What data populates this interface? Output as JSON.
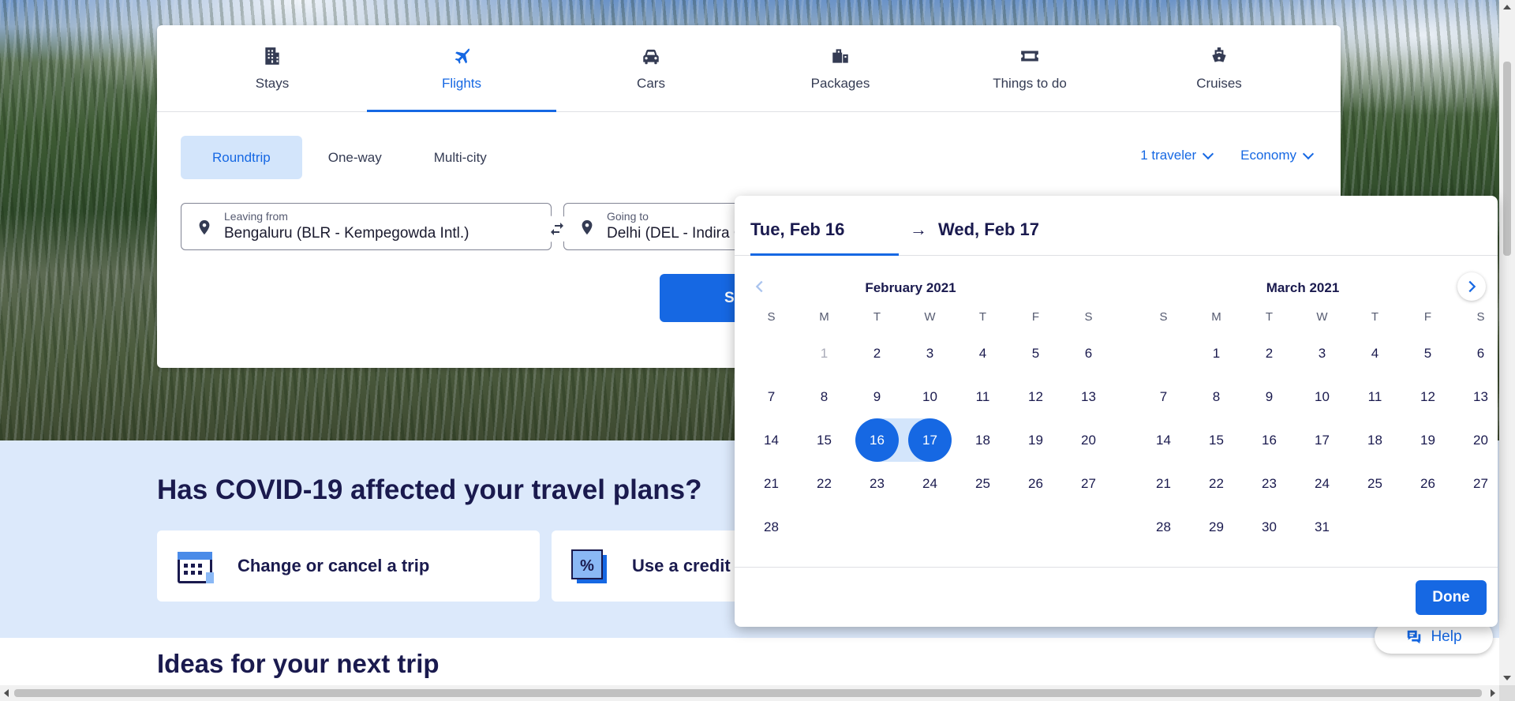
{
  "nav_tabs": [
    {
      "label": "Stays",
      "icon": "building-icon"
    },
    {
      "label": "Flights",
      "icon": "airplane-icon"
    },
    {
      "label": "Cars",
      "icon": "car-icon"
    },
    {
      "label": "Packages",
      "icon": "luggage-icon"
    },
    {
      "label": "Things to do",
      "icon": "ticket-icon"
    },
    {
      "label": "Cruises",
      "icon": "ship-icon"
    }
  ],
  "active_tab": "Flights",
  "trip_types": {
    "roundtrip": "Roundtrip",
    "oneway": "One-way",
    "multicity": "Multi-city"
  },
  "travelers": "1 traveler",
  "cabin_class": "Economy",
  "leaving_from": {
    "label": "Leaving from",
    "value": "Bengaluru (BLR - Kempegowda Intl.)"
  },
  "going_to": {
    "label": "Going to",
    "value": "Delhi (DEL - Indira Gandhi Intl.)"
  },
  "search_button": "Search",
  "covid": {
    "title": "Has COVID-19 affected your travel plans?",
    "cards": [
      {
        "label": "Change or cancel a trip",
        "icon": "calendar-icon"
      },
      {
        "label": "Use a credit",
        "icon": "percent-coupon-icon"
      }
    ]
  },
  "ideas_title": "Ideas for your next trip",
  "help_label": "Help",
  "datepicker": {
    "start_label": "Tue, Feb 16",
    "end_label": "Wed, Feb 17",
    "arrow": "→",
    "weekdays": [
      "S",
      "M",
      "T",
      "W",
      "T",
      "F",
      "S"
    ],
    "months": [
      {
        "title": "February 2021",
        "offset": 1,
        "days": 28,
        "disabled_before": 2,
        "selected": [
          16,
          17
        ]
      },
      {
        "title": "March 2021",
        "offset": 1,
        "days": 31,
        "disabled_before": 0,
        "selected": []
      }
    ],
    "done_label": "Done"
  },
  "colors": {
    "accent": "#1668e3",
    "accent_light": "#d3e5fb",
    "navy": "#1a1a4e"
  }
}
